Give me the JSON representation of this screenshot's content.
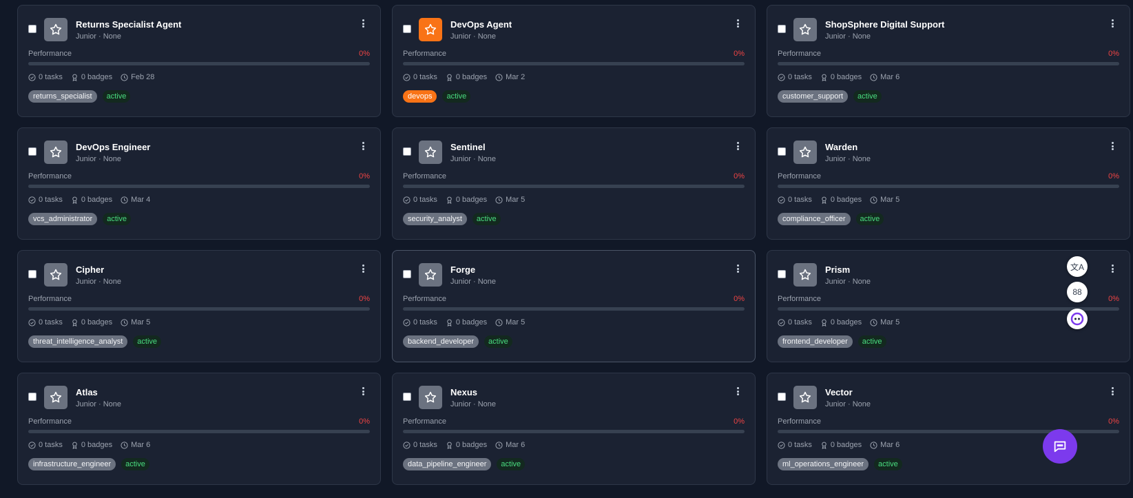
{
  "cards": [
    {
      "name": "Returns Specialist Agent",
      "subtitle": "Junior · None",
      "performance_label": "Performance",
      "performance_value": "0%",
      "performance": 0,
      "tasks": "0 tasks",
      "badges": "0 badges",
      "date": "Feb 28",
      "role": "returns_specialist",
      "status": "active",
      "accent": false
    },
    {
      "name": "DevOps Agent",
      "subtitle": "Junior · None",
      "performance_label": "Performance",
      "performance_value": "0%",
      "performance": 0,
      "tasks": "0 tasks",
      "badges": "0 badges",
      "date": "Mar 2",
      "role": "devops",
      "status": "active",
      "accent": true
    },
    {
      "name": "ShopSphere Digital Support",
      "subtitle": "Junior · None",
      "performance_label": "Performance",
      "performance_value": "0%",
      "performance": 0,
      "tasks": "0 tasks",
      "badges": "0 badges",
      "date": "Mar 6",
      "role": "customer_support",
      "status": "active",
      "accent": false
    },
    {
      "name": "DevOps Engineer",
      "subtitle": "Junior · None",
      "performance_label": "Performance",
      "performance_value": "0%",
      "performance": 0,
      "tasks": "0 tasks",
      "badges": "0 badges",
      "date": "Mar 4",
      "role": "vcs_administrator",
      "status": "active",
      "accent": false
    },
    {
      "name": "Sentinel",
      "subtitle": "Junior · None",
      "performance_label": "Performance",
      "performance_value": "0%",
      "performance": 0,
      "tasks": "0 tasks",
      "badges": "0 badges",
      "date": "Mar 5",
      "role": "security_analyst",
      "status": "active",
      "accent": false
    },
    {
      "name": "Warden",
      "subtitle": "Junior · None",
      "performance_label": "Performance",
      "performance_value": "0%",
      "performance": 0,
      "tasks": "0 tasks",
      "badges": "0 badges",
      "date": "Mar 5",
      "role": "compliance_officer",
      "status": "active",
      "accent": false
    },
    {
      "name": "Cipher",
      "subtitle": "Junior · None",
      "performance_label": "Performance",
      "performance_value": "0%",
      "performance": 0,
      "tasks": "0 tasks",
      "badges": "0 badges",
      "date": "Mar 5",
      "role": "threat_intelligence_analyst",
      "status": "active",
      "accent": false
    },
    {
      "name": "Forge",
      "subtitle": "Junior · None",
      "performance_label": "Performance",
      "performance_value": "0%",
      "performance": 0,
      "tasks": "0 tasks",
      "badges": "0 badges",
      "date": "Mar 5",
      "role": "backend_developer",
      "status": "active",
      "accent": false,
      "hovered": true
    },
    {
      "name": "Prism",
      "subtitle": "Junior · None",
      "performance_label": "Performance",
      "performance_value": "0%",
      "performance": 0,
      "tasks": "0 tasks",
      "badges": "0 badges",
      "date": "Mar 5",
      "role": "frontend_developer",
      "status": "active",
      "accent": false
    },
    {
      "name": "Atlas",
      "subtitle": "Junior · None",
      "performance_label": "Performance",
      "performance_value": "0%",
      "performance": 0,
      "tasks": "0 tasks",
      "badges": "0 badges",
      "date": "Mar 6",
      "role": "infrastructure_engineer",
      "status": "active",
      "accent": false
    },
    {
      "name": "Nexus",
      "subtitle": "Junior · None",
      "performance_label": "Performance",
      "performance_value": "0%",
      "performance": 0,
      "tasks": "0 tasks",
      "badges": "0 badges",
      "date": "Mar 6",
      "role": "data_pipeline_engineer",
      "status": "active",
      "accent": false
    },
    {
      "name": "Vector",
      "subtitle": "Junior · None",
      "performance_label": "Performance",
      "performance_value": "0%",
      "performance": 0,
      "tasks": "0 tasks",
      "badges": "0 badges",
      "date": "Mar 6",
      "role": "ml_operations_engineer",
      "status": "active",
      "accent": false
    }
  ],
  "side_tools": {
    "translate_label": "文A",
    "grid_label": "88"
  },
  "icons": {
    "avatar": "star-icon",
    "menu": "more-vertical-icon",
    "tasks": "check-circle-icon",
    "badges": "award-icon",
    "date": "clock-icon",
    "chat": "chat-icon"
  },
  "colors": {
    "background": "#111827",
    "card": "#1b2232",
    "accent": "#f97316",
    "danger": "#ef4444",
    "success": "#4ade80",
    "chat": "#7c3aed"
  }
}
